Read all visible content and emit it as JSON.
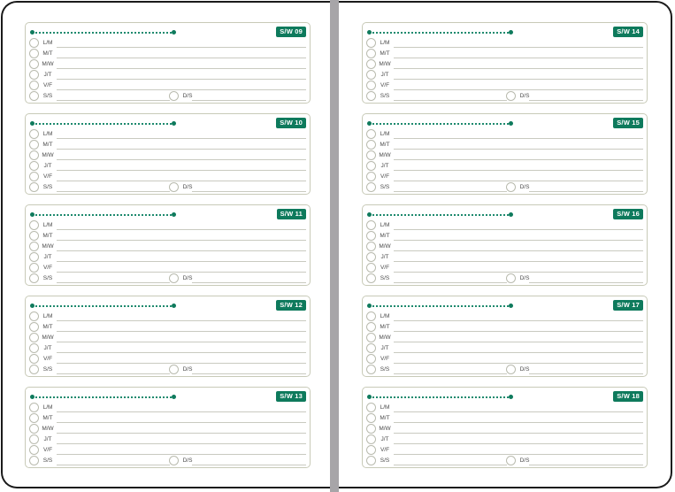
{
  "weeks": [
    {
      "label": "S/W 09"
    },
    {
      "label": "S/W 10"
    },
    {
      "label": "S/W 11"
    },
    {
      "label": "S/W 12"
    },
    {
      "label": "S/W 13"
    },
    {
      "label": "S/W 14"
    },
    {
      "label": "S/W 15"
    },
    {
      "label": "S/W 16"
    },
    {
      "label": "S/W 17"
    },
    {
      "label": "S/W 18"
    }
  ],
  "days": [
    "L/M",
    "M/T",
    "M/W",
    "J/T",
    "V/F",
    "S/S"
  ],
  "sunday_label": "D/S",
  "colors": {
    "accent": "#0e7a5c",
    "spine": "#a7a5a8",
    "border": "#1b1b1b"
  }
}
